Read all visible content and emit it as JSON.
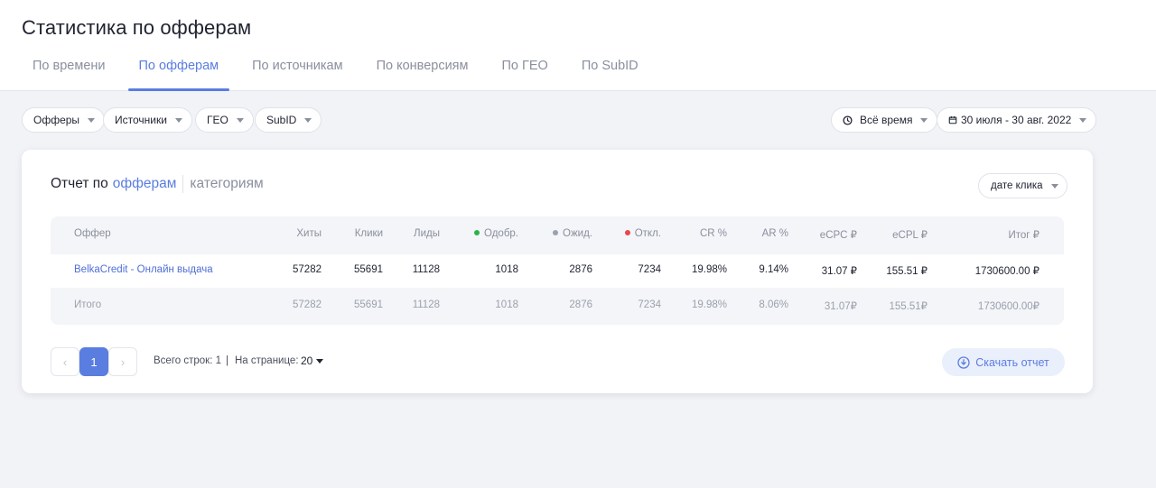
{
  "page": {
    "title": "Статистика по офферам"
  },
  "tabs": [
    {
      "label": "По времени"
    },
    {
      "label": "По офферам",
      "active": true
    },
    {
      "label": "По источникам"
    },
    {
      "label": "По конверсиям"
    },
    {
      "label": "По ГЕО"
    },
    {
      "label": "По SubID"
    }
  ],
  "filters": {
    "offers": "Офферы",
    "sources": "Источники",
    "geo": "ГЕО",
    "subid": "SubID",
    "period": "Всё время",
    "date_range": "30 июля - 30 авг. 2022"
  },
  "report": {
    "title_prefix": "Отчет по",
    "title_active": "офферам",
    "title_alt": "категориям",
    "sort_label": "дате клика"
  },
  "table": {
    "headers": {
      "offer": "Оффер",
      "hits": "Хиты",
      "clicks": "Клики",
      "leads": "Лиды",
      "approved": "Одобр.",
      "pending": "Ожид.",
      "rejected": "Откл.",
      "cr": "CR %",
      "ar": "AR %",
      "ecpc": "eCPC ₽",
      "ecpl": "eCPL ₽",
      "total": "Итог ₽"
    },
    "rows": [
      {
        "offer": "BelkaCredit - Онлайн выдача",
        "hits": "57282",
        "clicks": "55691",
        "leads": "11128",
        "approved": "1018",
        "pending": "2876",
        "rejected": "7234",
        "cr": "19.98%",
        "ar": "9.14%",
        "ecpc": "31.07 ₽",
        "ecpl": "155.51 ₽",
        "total": "1730600.00 ₽"
      }
    ],
    "totals": {
      "offer": "Итого",
      "hits": "57282",
      "clicks": "55691",
      "leads": "11128",
      "approved": "1018",
      "pending": "2876",
      "rejected": "7234",
      "cr": "19.98%",
      "ar": "8.06%",
      "ecpc": "31.07₽",
      "ecpl": "155.51₽",
      "total": "1730600.00₽"
    },
    "status_colors": {
      "approved": "#2bb24c",
      "pending": "#9aa0ae",
      "rejected": "#e5484d"
    }
  },
  "pagination": {
    "prev": "‹",
    "current_page": "1",
    "next": "›",
    "total_rows_text": "Всего строк: 1",
    "divider": "|",
    "per_page_label": "На странице:",
    "per_page_value": "20"
  },
  "actions": {
    "download_label": "Скачать отчет"
  },
  "colors": {
    "accent": "#5a7de0",
    "background": "#f2f3f7"
  }
}
